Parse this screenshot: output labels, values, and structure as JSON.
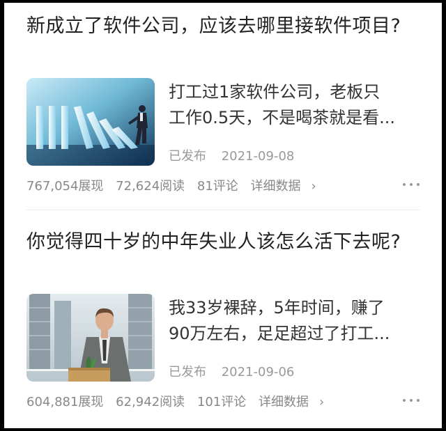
{
  "articles": [
    {
      "title": "新成立了软件公司，应该去哪里接软件项目?",
      "thumbnail_icon": "domino-businessman-image",
      "snippet_lines": [
        "打工过1家软件公司，老板只",
        "工作0.5天，不是喝茶就是看..."
      ],
      "status": "已发布",
      "date": "2021-09-08",
      "views": "767,054展现",
      "reads": "72,624阅读",
      "comments": "81评论",
      "detail_label": "详细数据",
      "chevron": "›"
    },
    {
      "title": "你觉得四十岁的中年失业人该怎么活下去呢?",
      "thumbnail_icon": "businessman-with-box-image",
      "snippet_lines": [
        "我33岁裸辞，5年时间，赚了",
        "90万左右，足足超过了打工..."
      ],
      "status": "已发布",
      "date": "2021-09-06",
      "views": "604,881展现",
      "reads": "62,942阅读",
      "comments": "101评论",
      "detail_label": "详细数据",
      "chevron": "›"
    }
  ],
  "colors": {
    "title": "#222222",
    "snippet": "#333333",
    "meta": "#999999",
    "background": "#ffffff",
    "frame": "#000000"
  }
}
